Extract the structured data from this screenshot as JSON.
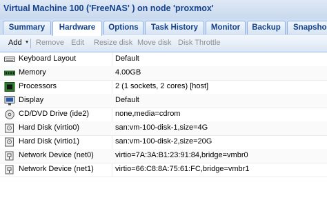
{
  "window": {
    "title": "Virtual Machine 100 ('FreeNAS' ) on node 'proxmox'"
  },
  "tabs": [
    {
      "label": "Summary",
      "active": false
    },
    {
      "label": "Hardware",
      "active": true
    },
    {
      "label": "Options",
      "active": false
    },
    {
      "label": "Task History",
      "active": false
    },
    {
      "label": "Monitor",
      "active": false
    },
    {
      "label": "Backup",
      "active": false
    },
    {
      "label": "Snapsho",
      "active": false
    }
  ],
  "toolbar": {
    "add_label": "Add",
    "remove_label": "Remove",
    "edit_label": "Edit",
    "resize_label": "Resize disk",
    "move_label": "Move disk",
    "throttle_label": "Disk Throttle"
  },
  "hardware": [
    {
      "icon": "keyboard-icon",
      "name": "Keyboard Layout",
      "value": "Default"
    },
    {
      "icon": "memory-icon",
      "name": "Memory",
      "value": "4.00GB"
    },
    {
      "icon": "processor-icon",
      "name": "Processors",
      "value": "2 (1 sockets, 2 cores) [host]"
    },
    {
      "icon": "display-icon",
      "name": "Display",
      "value": "Default"
    },
    {
      "icon": "cdrom-icon",
      "name": "CD/DVD Drive (ide2)",
      "value": "none,media=cdrom"
    },
    {
      "icon": "hard-disk-icon",
      "name": "Hard Disk (virtio0)",
      "value": "san:vm-100-disk-1,size=4G"
    },
    {
      "icon": "hard-disk-icon",
      "name": "Hard Disk (virtio1)",
      "value": "san:vm-100-disk-2,size=20G"
    },
    {
      "icon": "network-icon",
      "name": "Network Device (net0)",
      "value": "virtio=7A:3A:B1:23:91:84,bridge=vmbr0"
    },
    {
      "icon": "network-icon",
      "name": "Network Device (net1)",
      "value": "virtio=66:C8:8A:75:61:FC,bridge=vmbr1"
    }
  ],
  "colors": {
    "header_text": "#15428b",
    "header_bg": "#cfdef2",
    "border": "#99bbe8",
    "disabled_text": "#8f8f8f"
  }
}
